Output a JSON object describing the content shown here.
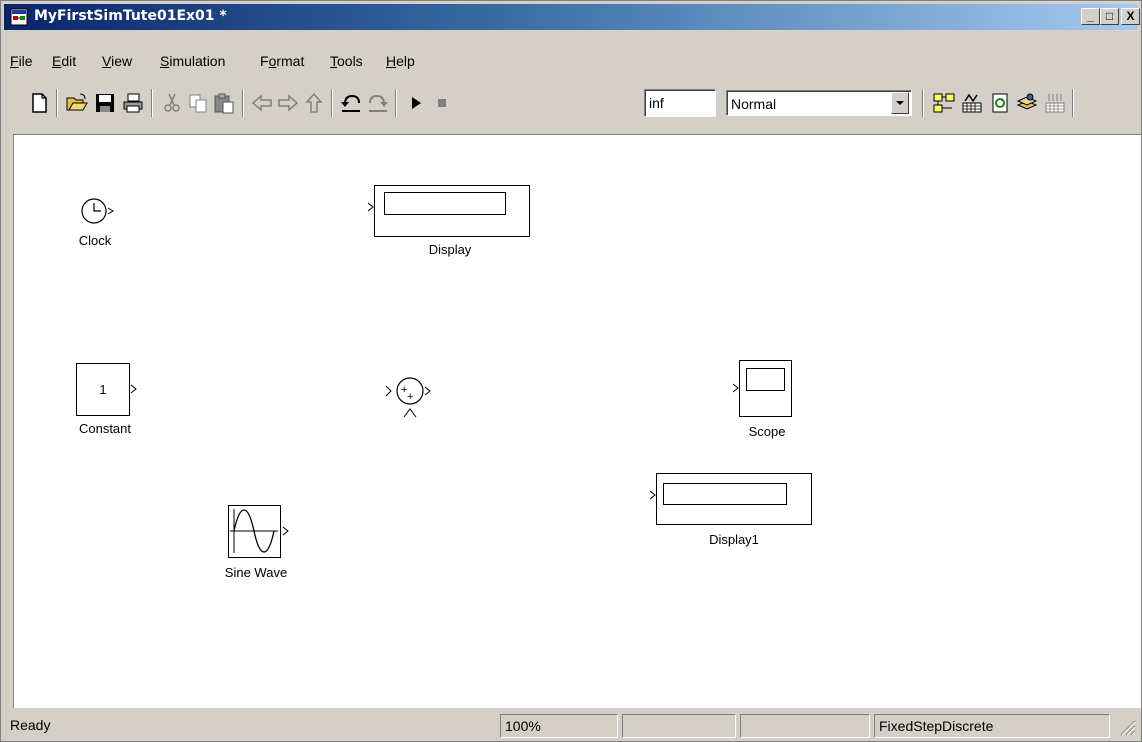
{
  "window": {
    "title": "MyFirstSimTute01Ex01 *",
    "controls": {
      "minimize": "_",
      "maximize": "□",
      "close": "X"
    }
  },
  "menu": {
    "items": [
      {
        "name": "file",
        "label": "File",
        "mnemonic": "F"
      },
      {
        "name": "edit",
        "label": "Edit",
        "mnemonic": "E"
      },
      {
        "name": "view",
        "label": "View",
        "mnemonic": "V"
      },
      {
        "name": "simulation",
        "label": "Simulation",
        "mnemonic": "S"
      },
      {
        "name": "format",
        "label": "Format",
        "mnemonic": "o"
      },
      {
        "name": "tools",
        "label": "Tools",
        "mnemonic": "T"
      },
      {
        "name": "help",
        "label": "Help",
        "mnemonic": "H"
      }
    ]
  },
  "toolbar": {
    "stop_time": "inf",
    "sim_mode": "Normal",
    "icons": [
      "new-icon",
      "open-icon",
      "save-icon",
      "print-icon",
      "cut-icon",
      "copy-icon",
      "paste-icon",
      "back-icon",
      "forward-icon",
      "up-icon",
      "undo-icon",
      "redo-icon",
      "start-icon",
      "stop-icon",
      "library-browser-icon",
      "model-explorer-icon",
      "update-diagram-icon",
      "build-icon",
      "debug-icon"
    ]
  },
  "blocks": {
    "clock": "Clock",
    "display": "Display",
    "constant": "Constant",
    "constant_value": "1",
    "sum_signs": "++",
    "scope": "Scope",
    "display1": "Display1",
    "sine_wave": "Sine Wave"
  },
  "status": {
    "state": "Ready",
    "zoom": "100%",
    "field3": "",
    "field4": "",
    "solver": "FixedStepDiscrete"
  },
  "colors": {
    "title_start": "#0a246a",
    "title_end": "#a6caf0",
    "chrome": "#d4d0c8",
    "canvas": "#ffffff"
  }
}
